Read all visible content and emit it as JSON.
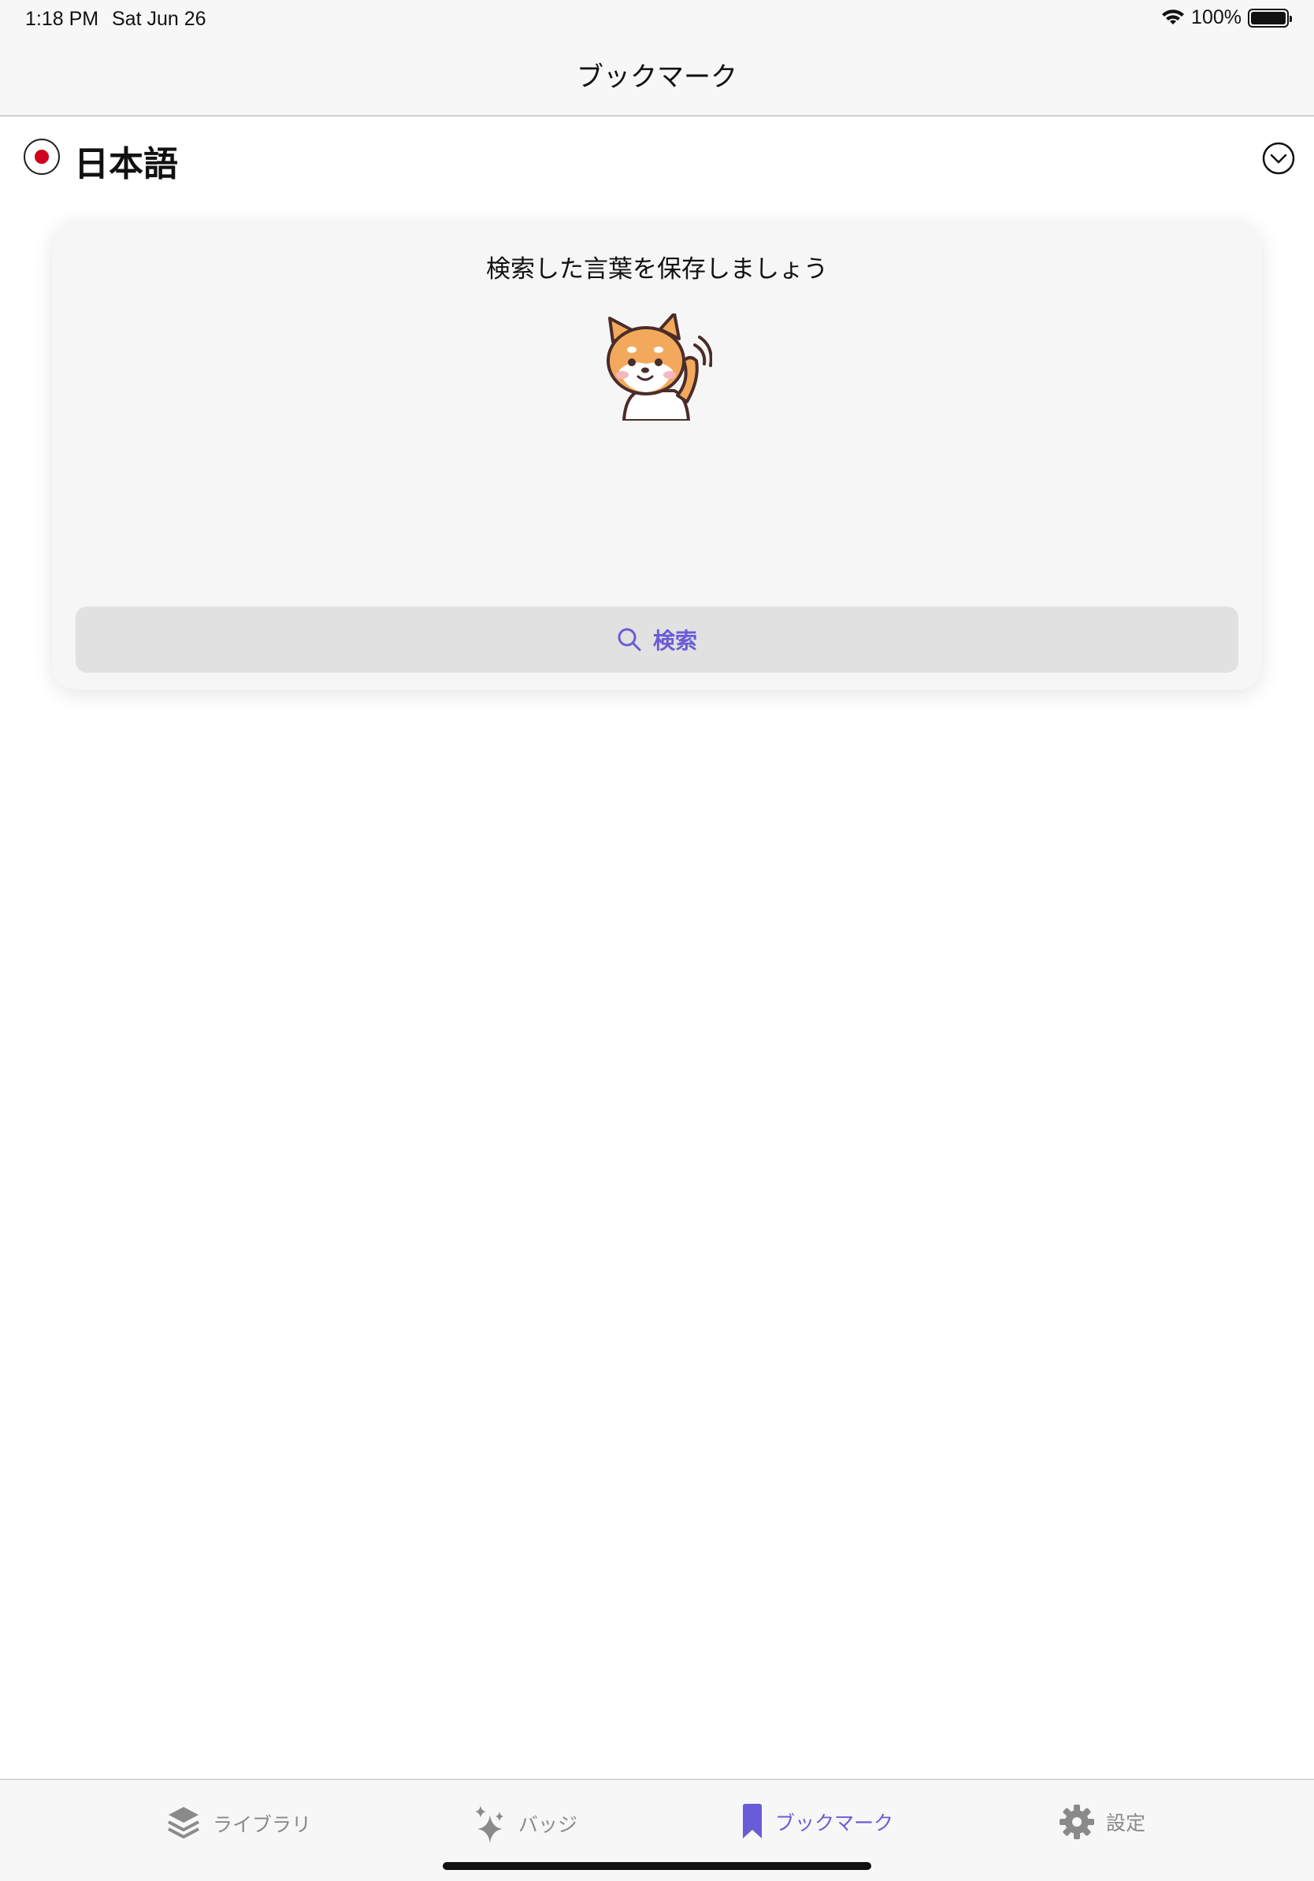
{
  "status_bar": {
    "time": "1:18 PM",
    "date": "Sat Jun 26",
    "battery": "100%",
    "icons": [
      "wifi-icon",
      "battery-icon"
    ]
  },
  "nav": {
    "title": "ブックマーク"
  },
  "language": {
    "name": "日本語",
    "flag": "japan-flag-icon",
    "dropdown": "chevron-down-circle-icon"
  },
  "card": {
    "message": "検索した言葉を保存しましょう",
    "mascot": "shiba-dog-waving",
    "search_button": {
      "label": "検索",
      "icon": "search-icon"
    }
  },
  "tabs": [
    {
      "label": "ライブラリ",
      "icon": "layers-icon",
      "active": false
    },
    {
      "label": "バッジ",
      "icon": "sparkles-icon",
      "active": false
    },
    {
      "label": "ブックマーク",
      "icon": "bookmark-icon",
      "active": true
    },
    {
      "label": "設定",
      "icon": "gear-icon",
      "active": false
    }
  ],
  "colors": {
    "accent": "#6a5cd8",
    "inactive": "#8a8a8a",
    "flag_red": "#d0021b"
  }
}
